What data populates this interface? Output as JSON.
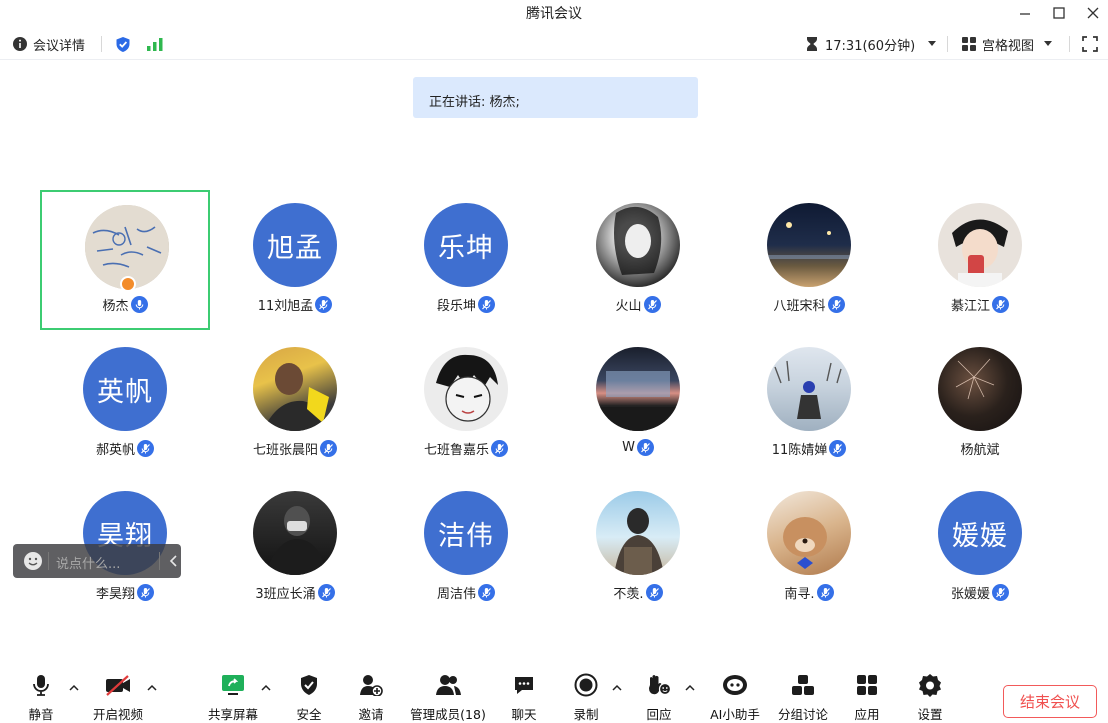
{
  "window": {
    "title": "腾讯会议"
  },
  "infobar": {
    "details_label": "会议详情",
    "duration": "17:31(60分钟)",
    "view_label": "宫格视图"
  },
  "speaking": {
    "text": "正在讲话: 杨杰;"
  },
  "participants": [
    {
      "name": "杨杰",
      "avatar_text": "",
      "muted": false
    },
    {
      "name": "11刘旭孟",
      "avatar_text": "旭孟",
      "muted": true
    },
    {
      "name": "段乐坤",
      "avatar_text": "乐坤",
      "muted": true
    },
    {
      "name": "火山",
      "avatar_text": "",
      "muted": true
    },
    {
      "name": "八班宋科",
      "avatar_text": "",
      "muted": true
    },
    {
      "name": "綦江江",
      "avatar_text": "",
      "muted": true
    },
    {
      "name": "郝英帆",
      "avatar_text": "英帆",
      "muted": true
    },
    {
      "name": "七班张晨阳",
      "avatar_text": "",
      "muted": true
    },
    {
      "name": "七班鲁嘉乐",
      "avatar_text": "",
      "muted": true
    },
    {
      "name": "W",
      "avatar_text": "",
      "muted": true
    },
    {
      "name": "11陈婧婵",
      "avatar_text": "",
      "muted": true
    },
    {
      "name": "杨航斌",
      "avatar_text": "",
      "muted": null
    },
    {
      "name": "李昊翔",
      "avatar_text": "昊翔",
      "muted": true
    },
    {
      "name": "3班应长涌",
      "avatar_text": "",
      "muted": true
    },
    {
      "name": "周洁伟",
      "avatar_text": "洁伟",
      "muted": true
    },
    {
      "name": "不羡.",
      "avatar_text": "",
      "muted": true
    },
    {
      "name": "南寻.",
      "avatar_text": "",
      "muted": true
    },
    {
      "name": "张媛媛",
      "avatar_text": "媛媛",
      "muted": true
    }
  ],
  "chat": {
    "placeholder": "说点什么..."
  },
  "toolbar": {
    "mute": "静音",
    "video": "开启视频",
    "share": "共享屏幕",
    "security": "安全",
    "invite": "邀请",
    "members": "管理成员(18)",
    "chat": "聊天",
    "record": "录制",
    "react": "回应",
    "ai": "AI小助手",
    "breakout": "分组讨论",
    "apps": "应用",
    "settings": "设置",
    "end": "结束会议"
  },
  "colors": {
    "accent": "#3570e8",
    "avatar_bg": "#3f6fd0",
    "active_border": "#3ccc72",
    "end": "#f0504f"
  }
}
